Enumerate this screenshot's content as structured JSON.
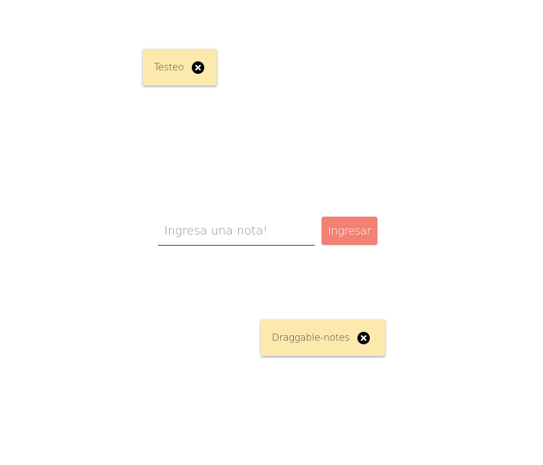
{
  "notes": [
    {
      "text": "Testeo",
      "close_icon": "close-circle-icon"
    },
    {
      "text": "Draggable-notes",
      "close_icon": "close-circle-icon"
    }
  ],
  "form": {
    "placeholder": "Ingresa una nota!",
    "value": "",
    "submit_label": "Ingresar"
  },
  "colors": {
    "note_background": "#fbe9ae",
    "button_background": "#f28174",
    "button_text": "#ffffff",
    "icon": "#000000"
  }
}
